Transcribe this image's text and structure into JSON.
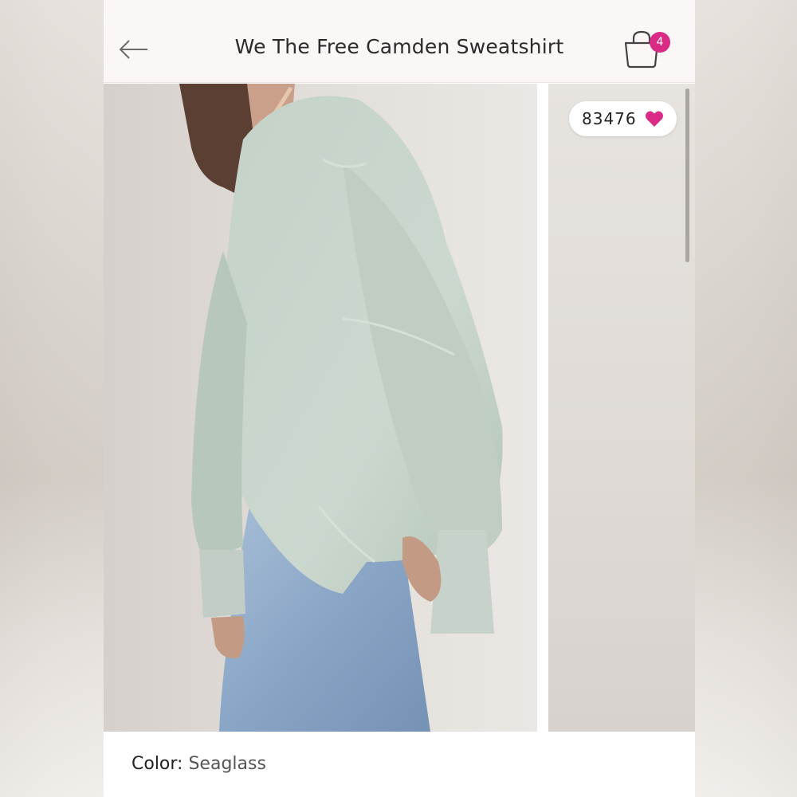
{
  "header": {
    "title": "We The Free Camden Sweatshirt",
    "cart_count": "4"
  },
  "gallery": {
    "like_count": "83476"
  },
  "product": {
    "color_label": "Color:",
    "color_value": "Seaglass"
  },
  "colors": {
    "accent": "#d92a86",
    "header_bg": "#fbf7f6",
    "sweatshirt": "#c9d6cd",
    "jeans": "#9fb6cf"
  },
  "icons": {
    "back": "arrow-left-icon",
    "cart": "shopping-bag-icon",
    "like": "heart-icon"
  }
}
